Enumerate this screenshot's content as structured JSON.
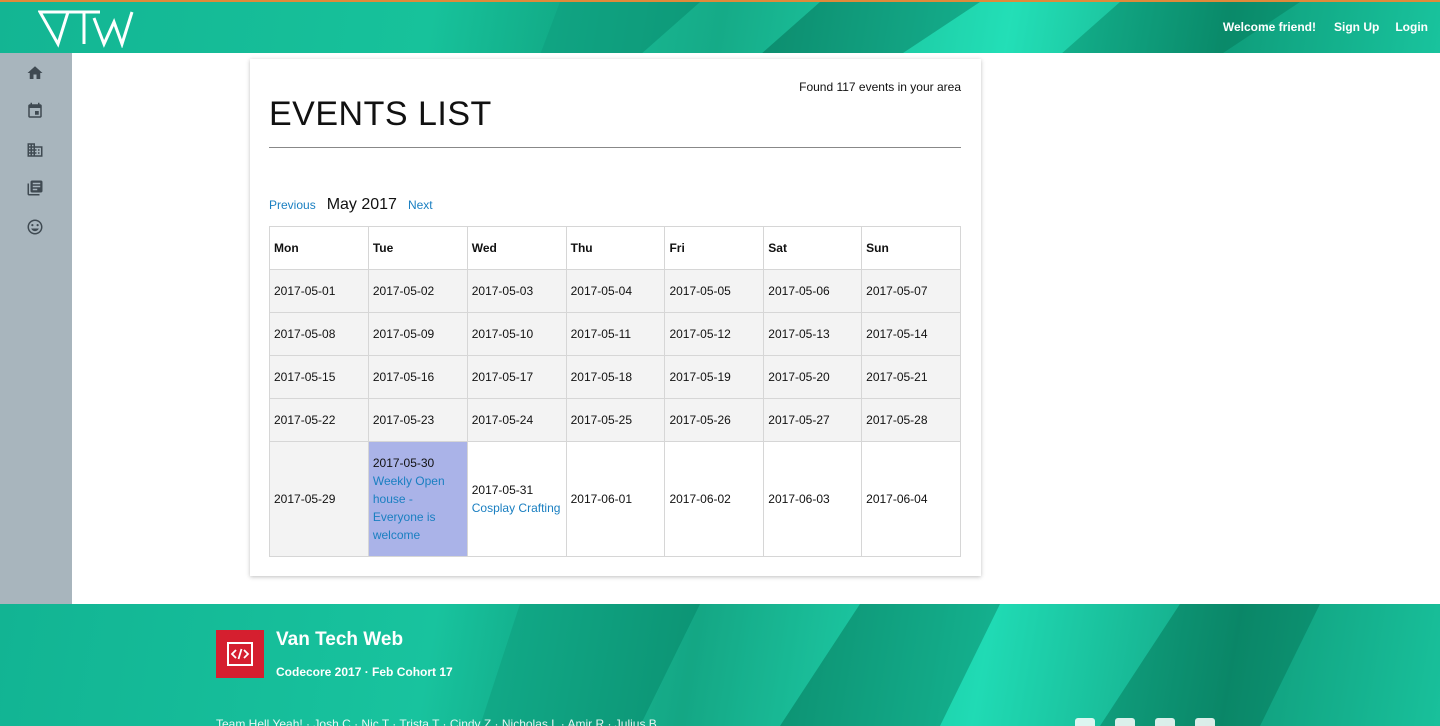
{
  "header": {
    "logo_alt": "VTW",
    "welcome": "Welcome friend!",
    "signup_label": "Sign Up",
    "login_label": "Login"
  },
  "sidebar": {
    "items": [
      {
        "icon": "home-icon"
      },
      {
        "icon": "calendar-icon"
      },
      {
        "icon": "building-icon"
      },
      {
        "icon": "library-icon"
      },
      {
        "icon": "smiley-icon"
      }
    ]
  },
  "events": {
    "found_text": "Found 117 events in your area",
    "title": "EVENTS LIST",
    "prev_label": "Previous",
    "month": "May 2017",
    "next_label": "Next",
    "weekdays": [
      "Mon",
      "Tue",
      "Wed",
      "Thu",
      "Fri",
      "Sat",
      "Sun"
    ],
    "weeks": [
      [
        "2017-05-01",
        "2017-05-02",
        "2017-05-03",
        "2017-05-04",
        "2017-05-05",
        "2017-05-06",
        "2017-05-07"
      ],
      [
        "2017-05-08",
        "2017-05-09",
        "2017-05-10",
        "2017-05-11",
        "2017-05-12",
        "2017-05-13",
        "2017-05-14"
      ],
      [
        "2017-05-15",
        "2017-05-16",
        "2017-05-17",
        "2017-05-18",
        "2017-05-19",
        "2017-05-20",
        "2017-05-21"
      ],
      [
        "2017-05-22",
        "2017-05-23",
        "2017-05-24",
        "2017-05-25",
        "2017-05-26",
        "2017-05-27",
        "2017-05-28"
      ],
      [
        "2017-05-29",
        "2017-05-30",
        "2017-05-31",
        "2017-06-01",
        "2017-06-02",
        "2017-06-03",
        "2017-06-04"
      ]
    ],
    "event_0530": "Weekly Open house - Everyone is welcome",
    "event_0531": "Cosplay Crafting",
    "highlight_color": "#aab3e8"
  },
  "footer": {
    "title": "Van Tech Web",
    "subtitle": "Codecore 2017 · Feb Cohort 17",
    "team": "Team Hell Yeah! · Josh C · Nic T · Trista T · Cindy Z · Nicholas L · Amir R · Julius B",
    "logo_icon": "code-icon",
    "social_icons": [
      "facebook-icon",
      "google-icon",
      "github-icon",
      "youtube-icon"
    ]
  }
}
